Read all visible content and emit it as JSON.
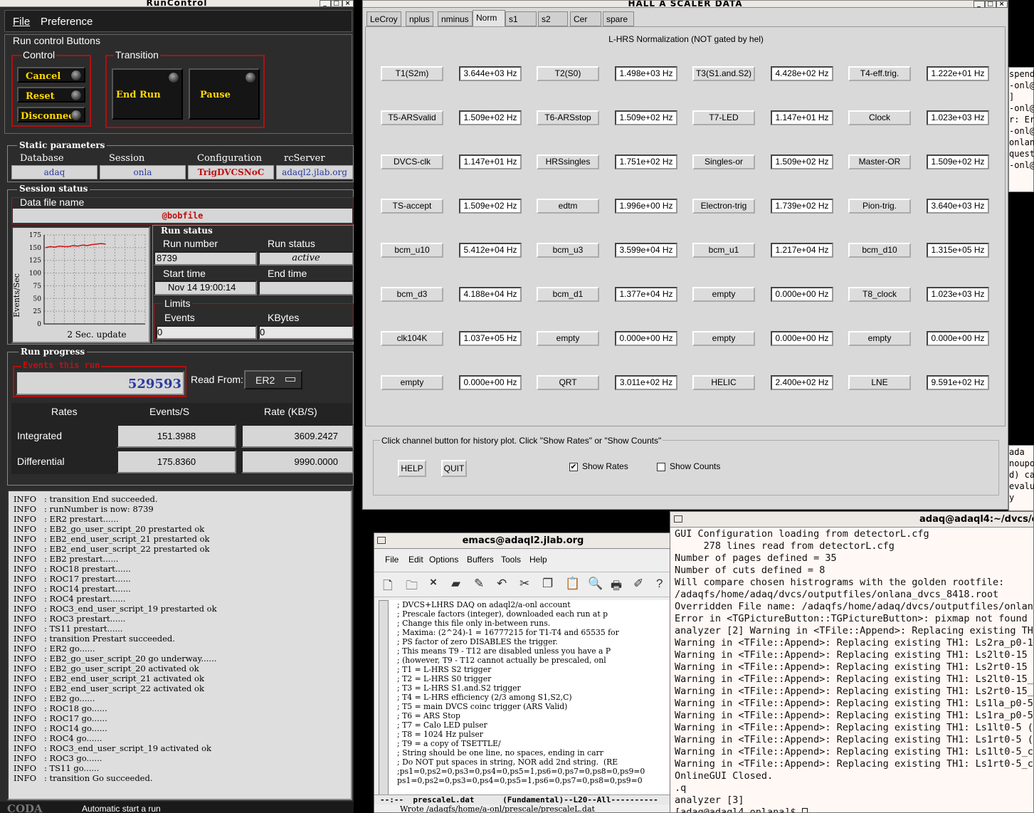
{
  "runcontrol": {
    "title": "RunControl",
    "menu": [
      "File",
      "Preference"
    ],
    "run_control_buttons": "Run control Buttons",
    "control_label": "Control",
    "transition_label": "Transition",
    "cancel": "Cancel",
    "reset": "Reset",
    "disconnect": "Disconnect",
    "end_run": "End Run",
    "pause": "Pause",
    "static_parameters": "Static parameters",
    "database_label": "Database",
    "session_label": "Session",
    "configuration_label": "Configuration",
    "rcserver_label": "rcServer",
    "database": "adaq",
    "session": "onla",
    "configuration": "TrigDVCSNoC",
    "rcserver": "adaql2.jlab.org",
    "session_status": "Session status",
    "data_file_name_label": "Data file name",
    "data_file_name": "@bobfile",
    "plot_ylabel": "Events/Sec",
    "plot_yticks": [
      "175",
      "150",
      "125",
      "100",
      "75",
      "50",
      "25",
      "0"
    ],
    "plot_caption": "2 Sec. update",
    "plot_series": [
      150,
      152,
      151,
      153,
      152,
      152,
      154,
      153,
      155,
      154,
      156,
      157,
      158,
      157
    ],
    "run_status_header": "Run status",
    "run_number_label": "Run number",
    "run_number": "8739",
    "run_status_label": "Run status",
    "run_status": "active",
    "start_time_label": "Start time",
    "start_time": "Nov 14 19:00:14",
    "end_time_label": "End time",
    "end_time": "",
    "limits_label": "Limits",
    "events_label": "Events",
    "kbytes_label": "KBytes",
    "events_limit": "0",
    "kbytes_limit": "0",
    "run_progress": "Run progress",
    "events_this_run_label": "Events this run",
    "events_this_run": "529593",
    "read_from_label": "Read From:",
    "read_from": "ER2",
    "rates_header": "Rates",
    "events_s_header": "Events/S",
    "rate_kb_header": "Rate (KB/S)",
    "integrated_label": "Integrated",
    "integrated_events": "151.3988",
    "integrated_rate": "3609.2427",
    "differential_label": "Differential",
    "differential_events": "175.8360",
    "differential_rate": "9990.0000",
    "log": [
      "INFO   : transition End succeeded.",
      "INFO   : runNumber is now: 8739",
      "INFO   : ER2 prestart......",
      "INFO   : EB2_go_user_script_20 prestarted ok",
      "INFO   : EB2_end_user_script_21 prestarted ok",
      "INFO   : EB2_end_user_script_22 prestarted ok",
      "INFO   : EB2 prestart......",
      "INFO   : ROC18 prestart......",
      "INFO   : ROC17 prestart......",
      "INFO   : ROC14 prestart......",
      "INFO   : ROC4 prestart......",
      "INFO   : ROC3_end_user_script_19 prestarted ok",
      "INFO   : ROC3 prestart......",
      "INFO   : TS11 prestart......",
      "INFO   : transition Prestart succeeded.",
      "INFO   : ER2 go......",
      "INFO   : EB2_go_user_script_20 go underway......",
      "INFO   : EB2_go_user_script_20 activated ok",
      "INFO   : EB2_end_user_script_21 activated ok",
      "INFO   : EB2_end_user_script_22 activated ok",
      "INFO   : EB2 go......",
      "INFO   : ROC18 go......",
      "INFO   : ROC17 go......",
      "INFO   : ROC14 go......",
      "INFO   : ROC4 go......",
      "INFO   : ROC3_end_user_script_19 activated ok",
      "INFO   : ROC3 go......",
      "INFO   : TS11 go......",
      "INFO   : transition Go succeeded."
    ],
    "footer": "Automatic start a run"
  },
  "scaler": {
    "title": "HALL  A  SCALER  DATA",
    "tabs": [
      "LeCroy",
      "nplus",
      "nminus",
      "Norm",
      "s1",
      "s2",
      "Cer",
      "spare"
    ],
    "active_tab": "Norm",
    "heading": "L-HRS Normalization (NOT gated by hel)",
    "rows": [
      [
        [
          "T1(S2m)",
          "3.644e+03 Hz"
        ],
        [
          "T2(S0)",
          "1.498e+03 Hz"
        ],
        [
          "T3(S1.and.S2)",
          "4.428e+02 Hz"
        ],
        [
          "T4-eff.trig.",
          "1.222e+01 Hz"
        ]
      ],
      [
        [
          "T5-ARSvalid",
          "1.509e+02 Hz"
        ],
        [
          "T6-ARSstop",
          "1.509e+02 Hz"
        ],
        [
          "T7-LED",
          "1.147e+01 Hz"
        ],
        [
          "Clock",
          "1.023e+03 Hz"
        ]
      ],
      [
        [
          "DVCS-clk",
          "1.147e+01 Hz"
        ],
        [
          "HRSsingles",
          "1.751e+02 Hz"
        ],
        [
          "Singles-or",
          "1.509e+02 Hz"
        ],
        [
          "Master-OR",
          "1.509e+02 Hz"
        ]
      ],
      [
        [
          "TS-accept",
          "1.509e+02 Hz"
        ],
        [
          "edtm",
          "1.996e+00 Hz"
        ],
        [
          "Electron-trig",
          "1.739e+02 Hz"
        ],
        [
          "Pion-trig.",
          "3.640e+03 Hz"
        ]
      ],
      [
        [
          "bcm_u10",
          "5.412e+04 Hz"
        ],
        [
          "bcm_u3",
          "3.599e+04 Hz"
        ],
        [
          "bcm_u1",
          "1.217e+04 Hz"
        ],
        [
          "bcm_d10",
          "1.315e+05 Hz"
        ]
      ],
      [
        [
          "bcm_d3",
          "4.188e+04 Hz"
        ],
        [
          "bcm_d1",
          "1.377e+04 Hz"
        ],
        [
          "empty",
          "0.000e+00 Hz"
        ],
        [
          "T8_clock",
          "1.023e+03 Hz"
        ]
      ],
      [
        [
          "clk104K",
          "1.037e+05 Hz"
        ],
        [
          "empty",
          "0.000e+00 Hz"
        ],
        [
          "empty",
          "0.000e+00 Hz"
        ],
        [
          "empty",
          "0.000e+00 Hz"
        ]
      ],
      [
        [
          "empty",
          "0.000e+00 Hz"
        ],
        [
          "QRT",
          "3.011e+02 Hz"
        ],
        [
          "HELIC",
          "2.400e+02 Hz"
        ],
        [
          "LNE",
          "9.591e+02 Hz"
        ]
      ]
    ],
    "hint": "Click channel button for history plot.  Click \"Show Rates\" or \"Show Counts\"",
    "help": "HELP",
    "quit": "QUIT",
    "show_rates": "Show Rates",
    "show_counts": "Show Counts"
  },
  "emacs": {
    "title": "emacs@adaql2.jlab.org",
    "menu": [
      "File",
      "Edit",
      "Options",
      "Buffers",
      "Tools",
      "Help"
    ],
    "lines": [
      "; DVCS+LHRS DAQ on adaql2/a-onl account",
      "; Prescale factors (integer), downloaded each run at p",
      "; Change this file only in-between runs.",
      "; Maxima: (2^24)-1 = 16777215 for T1-T4 and 65535 for",
      "; PS factor of zero DISABLES the trigger.",
      "; This means T9 - T12 are disabled unless you have a P",
      "; (however, T9 - T12 cannot actually be prescaled, onl",
      "; T1 = L-HRS S2 trigger",
      "; T2 = L-HRS S0 trigger",
      "; T3 = L-HRS S1.and.S2 trigger",
      "; T4 = L-HRS efficiency (2/3 among S1,S2,C)",
      "; T5 = main DVCS coinc trigger (ARS Valid)",
      "; T6 = ARS Stop",
      "; T7 = Calo LED pulser",
      "; T8 = 1024 Hz pulser",
      "; T9 = a copy of TSETTLE/",
      "; String should be one line, no spaces, ending in carr",
      "; Do NOT put spaces in string, NOR add 2nd string.  (RE",
      ";ps1=0,ps2=0,ps3=0,ps4=0,ps5=1,ps6=0,ps7=0,ps8=0,ps9=0",
      "ps1=0,ps2=0,ps3=0,ps4=0,ps5=1,ps6=0,ps7=0,ps8=0,ps9=0"
    ],
    "modeline": "--:--  prescaleL.dat      (Fundamental)--L20--All----------",
    "minibuffer": "Wrote /adaqfs/home/a-onl/prescale/prescaleL.dat"
  },
  "terminal": {
    "title": "adaq@adaql4:~/dvcs/o",
    "lines": [
      "GUI Configuration loading from detectorL.cfg",
      "     278 lines read from detectorL.cfg",
      "Number of pages defined = 35",
      "Number of cuts defined = 8",
      "Will compare chosen histrograms with the golden rootfile:",
      "/adaqfs/home/adaq/dvcs/outputfiles/onlana_dvcs_8418.root",
      "Overridden File name: /adaqfs/home/adaq/dvcs/outputfiles/onlana_",
      "Error in <TGPictureButton::TGPictureButton>: pixmap not found fo",
      "analyzer [2] Warning in <TFile::Append>: Replacing existing TH1",
      "Warning in <TFile::Append>: Replacing existing TH1: Ls2ra_p0-15",
      "Warning in <TFile::Append>: Replacing existing TH1: Ls2lt0-15 (P",
      "Warning in <TFile::Append>: Replacing existing TH1: Ls2rt0-15 (P",
      "Warning in <TFile::Append>: Replacing existing TH1: Ls2lt0-15_co",
      "Warning in <TFile::Append>: Replacing existing TH1: Ls2rt0-15_co",
      "Warning in <TFile::Append>: Replacing existing TH1: Ls1la_p0-5",
      "Warning in <TFile::Append>: Replacing existing TH1: Ls1ra_p0-5",
      "Warning in <TFile::Append>: Replacing existing TH1: Ls1lt0-5 (Po",
      "Warning in <TFile::Append>: Replacing existing TH1: Ls1rt0-5 (Po",
      "Warning in <TFile::Append>: Replacing existing TH1: Ls1lt0-5_cou",
      "Warning in <TFile::Append>: Replacing existing TH1: Ls1rt0-5_cou",
      "OnlineGUI Closed.",
      ".q",
      "analyzer [3]",
      "[adaq@adaql4 onlana]$ "
    ]
  },
  "side_a": [
    "spend",
    "-onl@",
    "]",
    "-onl@",
    "r: Er",
    "-onl@",
    "onlan",
    "quest",
    "-onl@"
  ],
  "side_b": [
    "ada",
    "noupo",
    "d) ca",
    "evalu",
    "y"
  ]
}
